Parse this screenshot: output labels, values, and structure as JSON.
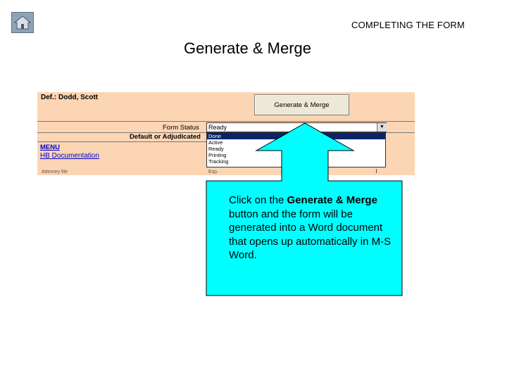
{
  "section_title": "COMPLETING THE FORM",
  "slide_title": "Generate & Merge",
  "nav": {
    "home_icon": "home-icon"
  },
  "sheet": {
    "defendant": "Def.: Dodd, Scott",
    "generate_button": "Generate & Merge",
    "form_status_label": "Form Status",
    "form_status_value": "Ready",
    "default_adjudicated_label": "Default or Adjudicated",
    "status_options": [
      "Done",
      "Active",
      "Ready",
      "Printing",
      "Tracking"
    ],
    "selected_option": "Done",
    "menu_link": "MENU",
    "documentation_link": "HB Documentation",
    "footer_left": "Attorney file",
    "footer_right": "Exp.",
    "dropdown_icon": "chevron-down-icon"
  },
  "callout": {
    "pre": "Click on the ",
    "bold1": "Generate & Merge",
    "post": " button and the form will be generated into a Word document that opens up automatically in M-S Word."
  },
  "colors": {
    "callout": "#00ffff",
    "sheet_bg": "#fcd5b4",
    "link": "#0000cc",
    "highlight": "#0a246a"
  }
}
